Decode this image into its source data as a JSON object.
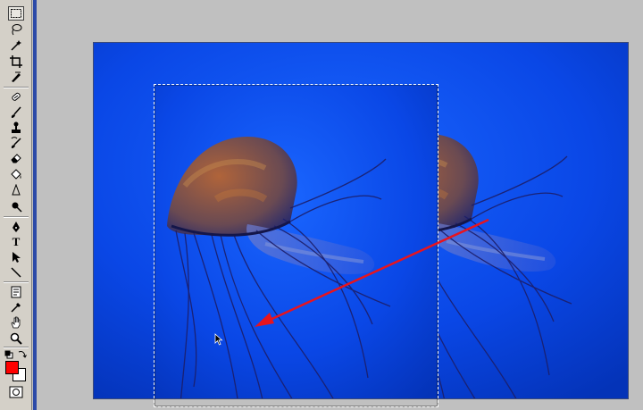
{
  "toolbox": {
    "tools": [
      {
        "icon": "rectangular-marquee-icon",
        "active": true
      },
      {
        "icon": "lasso-icon"
      },
      {
        "icon": "magic-wand-icon"
      },
      {
        "icon": "crop-icon"
      },
      {
        "icon": "slice-icon"
      },
      {
        "icon": "healing-brush-icon"
      },
      {
        "icon": "brush-icon"
      },
      {
        "icon": "clone-stamp-icon"
      },
      {
        "icon": "history-brush-icon"
      },
      {
        "icon": "eraser-icon"
      },
      {
        "icon": "paint-bucket-icon"
      },
      {
        "icon": "blur-icon"
      },
      {
        "icon": "dodge-icon"
      },
      {
        "icon": "pen-icon"
      },
      {
        "icon": "type-icon",
        "glyph": "T"
      },
      {
        "icon": "path-selection-icon"
      },
      {
        "icon": "line-icon"
      },
      {
        "icon": "notes-icon"
      },
      {
        "icon": "eyedropper-icon"
      },
      {
        "icon": "hand-icon"
      },
      {
        "icon": "zoom-icon"
      }
    ],
    "foreground_color": "#ff0000",
    "background_color": "#ffffff"
  },
  "canvas": {
    "background_color": "#0a3fe0",
    "subject": "jellyfish-photo"
  },
  "selection": {
    "type": "rectangular-marquee"
  },
  "annotation": {
    "type": "arrow",
    "color": "#e8141e"
  }
}
